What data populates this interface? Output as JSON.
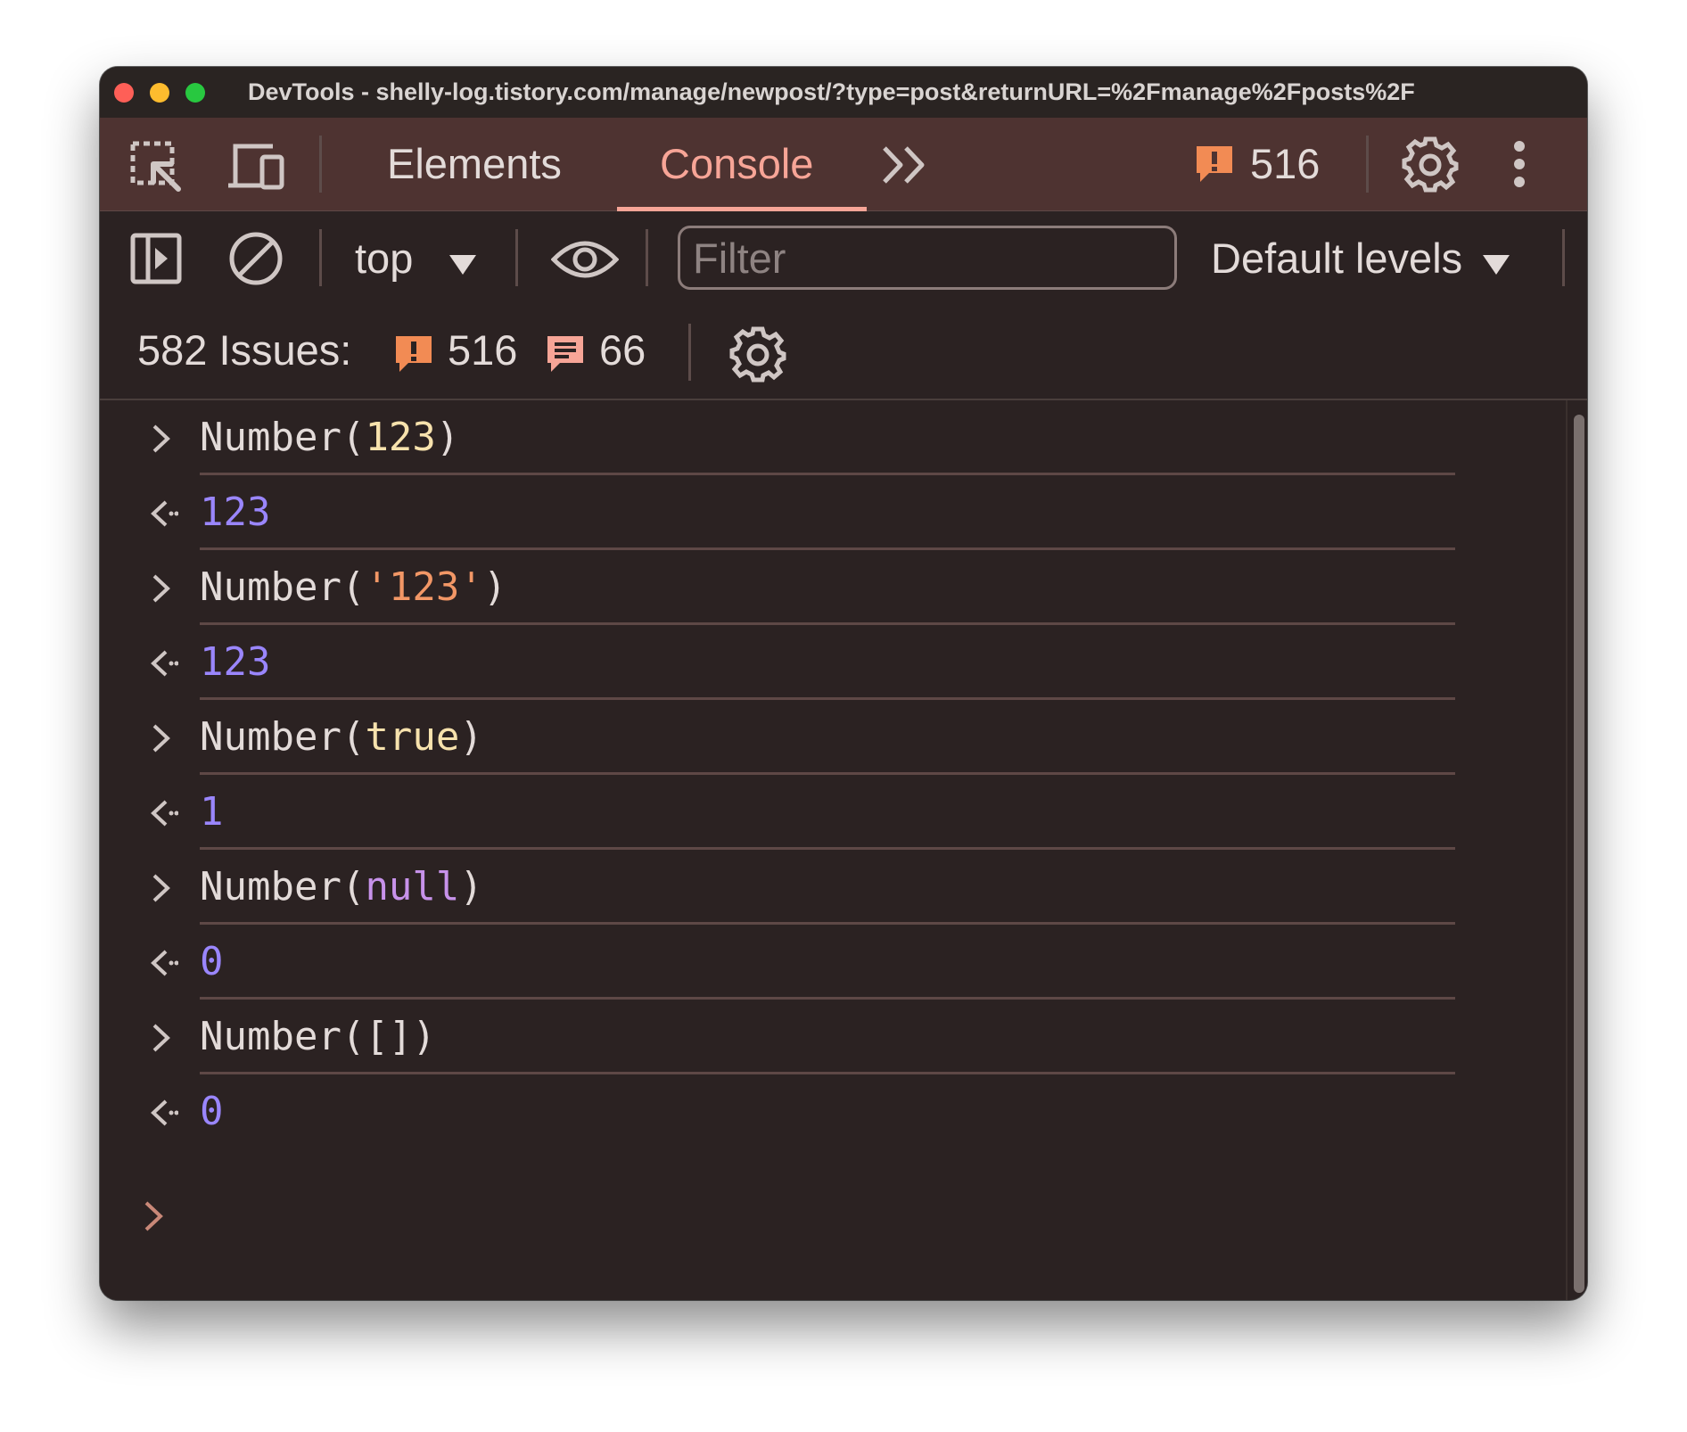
{
  "window": {
    "title": "DevTools - shelly-log.tistory.com/manage/newpost/?type=post&returnURL=%2Fmanage%2Fposts%2F"
  },
  "toolbar": {
    "tabs": [
      {
        "label": "Elements",
        "active": false
      },
      {
        "label": "Console",
        "active": true
      }
    ],
    "more_tabs_icon": "double-chevron-icon",
    "warning_count": "516"
  },
  "console_toolbar": {
    "context": "top",
    "filter_placeholder": "Filter",
    "filter_value": "",
    "levels": "Default levels"
  },
  "issues": {
    "label": "582 Issues:",
    "warnings": "516",
    "info": "66"
  },
  "console": {
    "entries": [
      {
        "type": "input",
        "parts": [
          {
            "t": "Number(",
            "c": "plain"
          },
          {
            "t": "123",
            "c": "lit"
          },
          {
            "t": ")",
            "c": "plain"
          }
        ]
      },
      {
        "type": "output",
        "parts": [
          {
            "t": "123",
            "c": "num"
          }
        ]
      },
      {
        "type": "input",
        "parts": [
          {
            "t": "Number(",
            "c": "plain"
          },
          {
            "t": "'123'",
            "c": "str"
          },
          {
            "t": ")",
            "c": "plain"
          }
        ]
      },
      {
        "type": "output",
        "parts": [
          {
            "t": "123",
            "c": "num"
          }
        ]
      },
      {
        "type": "input",
        "parts": [
          {
            "t": "Number(",
            "c": "plain"
          },
          {
            "t": "true",
            "c": "lit"
          },
          {
            "t": ")",
            "c": "plain"
          }
        ]
      },
      {
        "type": "output",
        "parts": [
          {
            "t": "1",
            "c": "num"
          }
        ]
      },
      {
        "type": "input",
        "parts": [
          {
            "t": "Number(",
            "c": "plain"
          },
          {
            "t": "null",
            "c": "kw"
          },
          {
            "t": ")",
            "c": "plain"
          }
        ]
      },
      {
        "type": "output",
        "parts": [
          {
            "t": "0",
            "c": "num"
          }
        ]
      },
      {
        "type": "input",
        "parts": [
          {
            "t": "Number([])",
            "c": "plain"
          }
        ]
      },
      {
        "type": "output",
        "parts": [
          {
            "t": "0",
            "c": "num"
          }
        ]
      }
    ]
  },
  "colors": {
    "accent": "#f7a597",
    "warning": "#f28b54",
    "number": "#9a86fd",
    "string": "#f29766",
    "literal": "#f7e2ad",
    "keyword": "#c792ea"
  }
}
